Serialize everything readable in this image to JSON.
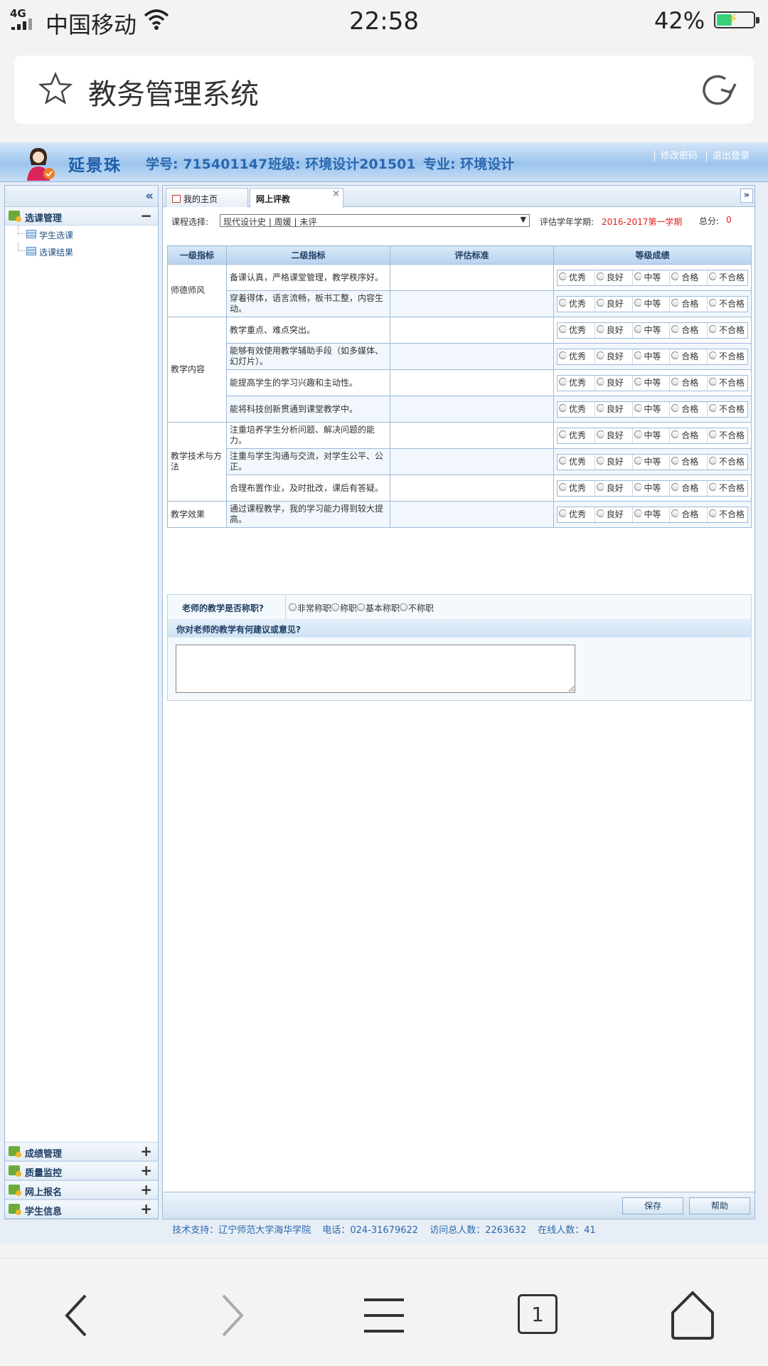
{
  "status_bar": {
    "network": "4G",
    "carrier": "中国移动",
    "time": "22:58",
    "battery_pct": "42%",
    "battery_level": 0.42
  },
  "browser": {
    "title": "教务管理系统",
    "tab_count": "1"
  },
  "header": {
    "name": "延景珠",
    "student_id": "学号: 715401147",
    "class": "班级: 环境设计201501",
    "major": "专业: 环境设计",
    "links": [
      "修改密码",
      "退出登录"
    ]
  },
  "sidebar": {
    "collapse_glyph": "«",
    "sections": [
      {
        "label": "选课管理",
        "toggle": "−",
        "items": [
          {
            "label": "学生选课"
          },
          {
            "label": "选课结果"
          }
        ]
      }
    ],
    "bottom_sections": [
      {
        "label": "成绩管理",
        "toggle": "+"
      },
      {
        "label": "质量监控",
        "toggle": "+"
      },
      {
        "label": "网上报名",
        "toggle": "+"
      },
      {
        "label": "学生信息",
        "toggle": "+"
      }
    ]
  },
  "tabs": [
    {
      "label": "我的主页"
    },
    {
      "label": "网上评教",
      "close": "×"
    }
  ],
  "filter": {
    "course_label": "课程选择:",
    "course_value": "现代设计史 | 周媛 | 未评",
    "term_label": "评估学年学期:",
    "term_value": "2016-2017第一学期",
    "score_label": "总分:",
    "score_value": "0"
  },
  "table": {
    "headers": [
      "一级指标",
      "二级指标",
      "评估标准",
      "等级成绩"
    ],
    "grades": [
      "优秀",
      "良好",
      "中等",
      "合格",
      "不合格"
    ],
    "groups": [
      {
        "l1": "师德师风",
        "items": [
          "备课认真，严格课堂管理，教学秩序好。",
          "穿着得体，语言流畅，板书工整，内容生动。"
        ]
      },
      {
        "l1": "教学内容",
        "items": [
          "教学重点、难点突出。",
          "能够有效使用教学辅助手段（如多媒体、幻灯片）。",
          "能提高学生的学习兴趣和主动性。",
          "能将科技创新贯通到课堂教学中。"
        ]
      },
      {
        "l1": "教学技术与方法",
        "items": [
          "注重培养学生分析问题、解决问题的能力。",
          "注重与学生沟通与交流，对学生公平、公正。",
          "合理布置作业，及时批改，课后有答疑。"
        ]
      },
      {
        "l1": "教学效果",
        "items": [
          "通过课程教学，我的学习能力得到较大提高。"
        ]
      }
    ]
  },
  "competency": {
    "question": "老师的教学是否称职?",
    "options": [
      "非常称职",
      "称职",
      "基本称职",
      "不称职"
    ]
  },
  "suggestion": {
    "question": "你对老师的教学有何建议或意见?"
  },
  "buttons": {
    "save": "保存",
    "help": "帮助"
  },
  "footer": {
    "support": "技术支持：辽宁师范大学海华学院",
    "phone": "电话：024-31679622",
    "visits": "访问总人数：2263632",
    "online": "在线人数：41"
  }
}
